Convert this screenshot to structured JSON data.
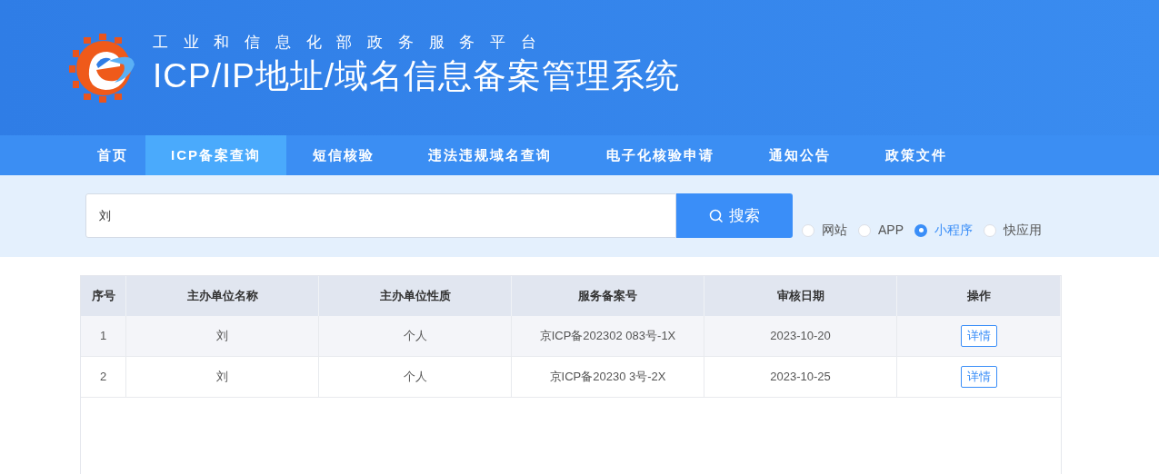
{
  "header": {
    "subtitle": "工 业 和 信 息 化 部 政 务 服 务 平 台",
    "title": "ICP/IP地址/域名信息备案管理系统"
  },
  "nav": [
    {
      "label": "首页",
      "selected": false
    },
    {
      "label": "ICP备案查询",
      "selected": true
    },
    {
      "label": "短信核验",
      "selected": false
    },
    {
      "label": "违法违规域名查询",
      "selected": false
    },
    {
      "label": "电子化核验申请",
      "selected": false
    },
    {
      "label": "通知公告",
      "selected": false
    },
    {
      "label": "政策文件",
      "selected": false
    }
  ],
  "search": {
    "value": "刘",
    "button": "搜索",
    "types": [
      {
        "label": "网站",
        "selected": false
      },
      {
        "label": "APP",
        "selected": false
      },
      {
        "label": "小程序",
        "selected": true
      },
      {
        "label": "快应用",
        "selected": false
      }
    ]
  },
  "table": {
    "columns": [
      "序号",
      "主办单位名称",
      "主办单位性质",
      "服务备案号",
      "审核日期",
      "操作"
    ],
    "rows": [
      {
        "cells": [
          "1",
          "刘",
          "个人",
          "京ICP备202302 083号-1X",
          "2023-10-20"
        ],
        "action": "详情"
      },
      {
        "cells": [
          "2",
          "刘",
          "个人",
          "京ICP备20230 3号-2X",
          "2023-10-25"
        ],
        "action": "详情"
      }
    ]
  }
}
